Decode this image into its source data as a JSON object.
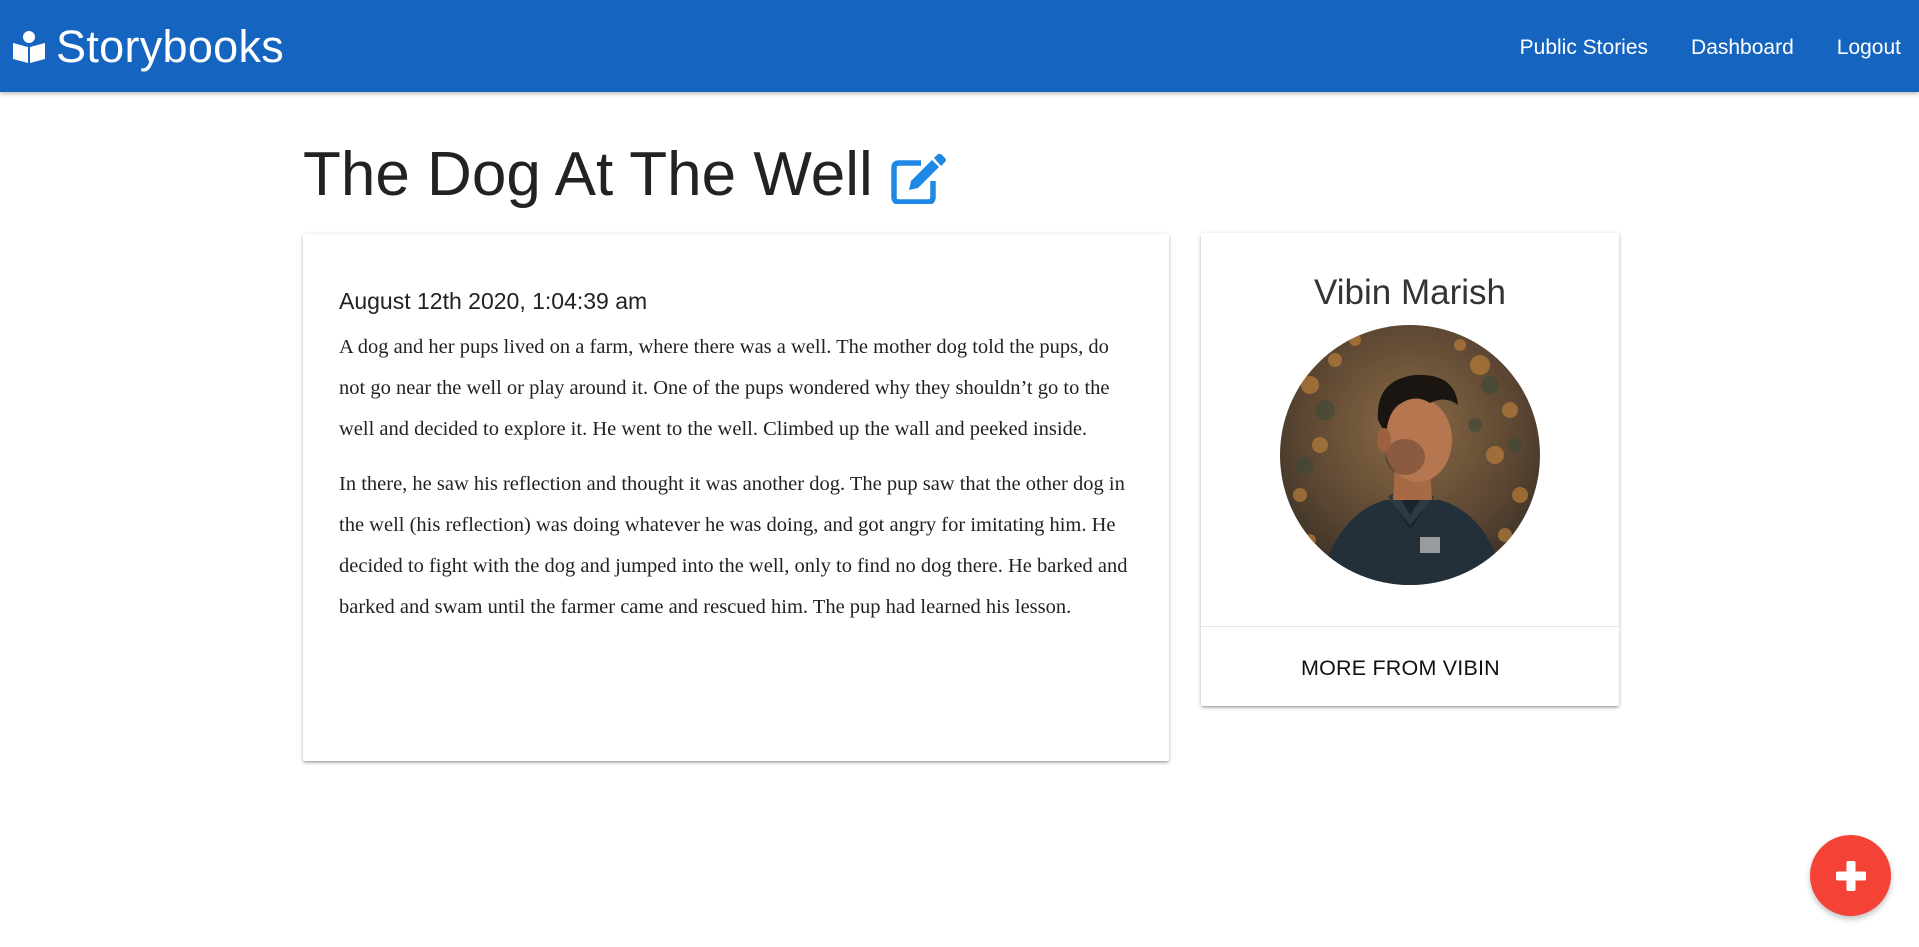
{
  "navbar": {
    "brand_label": "Storybooks",
    "brand_icon": "book-reader-icon",
    "links": [
      "Public Stories",
      "Dashboard",
      "Logout"
    ],
    "color": "#1565c0"
  },
  "story": {
    "title": "The Dog At The Well",
    "edit_icon": "edit-icon",
    "date": "August 12th 2020, 1:04:39 am",
    "paragraphs": [
      "A dog and her pups lived on a farm, where there was a well. The mother dog told the pups, do not go near the well or play around it. One of the pups wondered why they shouldn’t go to the well and decided to explore it. He went to the well. Climbed up the wall and peeked inside.",
      "In there, he saw his reflection and thought it was another dog. The pup saw that the other dog in the well (his reflection) was doing whatever he was doing, and got angry for imitating him. He decided to fight with the dog and jumped into the well, only to find no dog there. He barked and barked and swam until the farmer came and rescued him. The pup had learned his lesson."
    ]
  },
  "author": {
    "name": "Vibin Marish",
    "more_label": "MORE FROM VIBIN"
  },
  "fab": {
    "icon": "plus-icon",
    "color": "#f44336"
  },
  "accent_color": "#1e88e5"
}
